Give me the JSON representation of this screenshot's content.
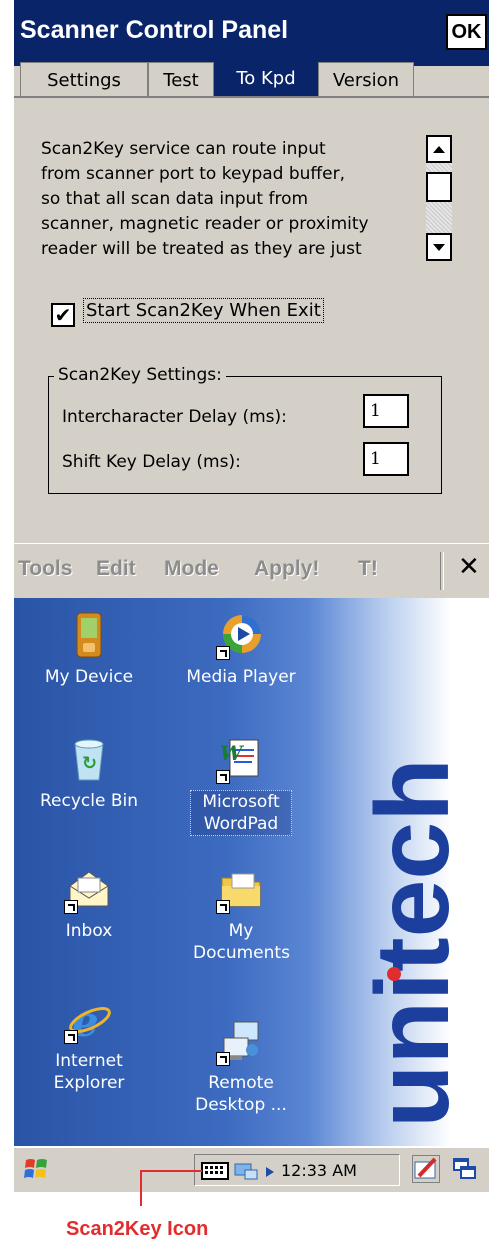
{
  "window": {
    "title": "Scanner Control Panel",
    "ok_label": "OK",
    "tabs": [
      {
        "label": "Settings",
        "active": false
      },
      {
        "label": "Test",
        "active": false
      },
      {
        "label": "To Kpd",
        "active": true
      },
      {
        "label": "Version",
        "active": false
      }
    ],
    "description_lines": [
      "Scan2Key service can route input",
      "from scanner port to keypad buffer,",
      "so that all scan data input from",
      "scanner, magnetic reader or proximity",
      "reader will be treated as they are just"
    ],
    "checkbox": {
      "label": "Start Scan2Key When Exit",
      "checked": true,
      "mark": "✔"
    },
    "group": {
      "title": "Scan2Key Settings:",
      "fields": [
        {
          "label": "Intercharacter Delay (ms):",
          "value": "1"
        },
        {
          "label": "Shift Key Delay (ms):",
          "value": "1"
        }
      ]
    },
    "menu": {
      "items": [
        "Tools",
        "Edit",
        "Mode",
        "Apply!",
        "T!"
      ],
      "close_glyph": "✕"
    }
  },
  "desktop": {
    "icons": [
      {
        "label": "My Device",
        "icon": "my-device-icon"
      },
      {
        "label": "Media Player",
        "icon": "media-player-icon"
      },
      {
        "label": "Recycle Bin",
        "icon": "recycle-bin-icon"
      },
      {
        "label": "Microsoft WordPad",
        "icon": "wordpad-icon"
      },
      {
        "label": "Inbox",
        "icon": "inbox-icon"
      },
      {
        "label": "My Documents",
        "icon": "folder-icon"
      },
      {
        "label": "Internet Explorer",
        "icon": "internet-explorer-icon"
      },
      {
        "label": "Remote Desktop ...",
        "icon": "remote-desktop-icon"
      }
    ],
    "brand": "unitech"
  },
  "taskbar": {
    "time": "12:33 AM"
  },
  "callout": {
    "label": "Scan2Key Icon",
    "color": "#e12d2d"
  },
  "colors": {
    "titlebar": "#0a246a",
    "panel": "#d4d0c8",
    "desktop": "#3d6bc0"
  }
}
